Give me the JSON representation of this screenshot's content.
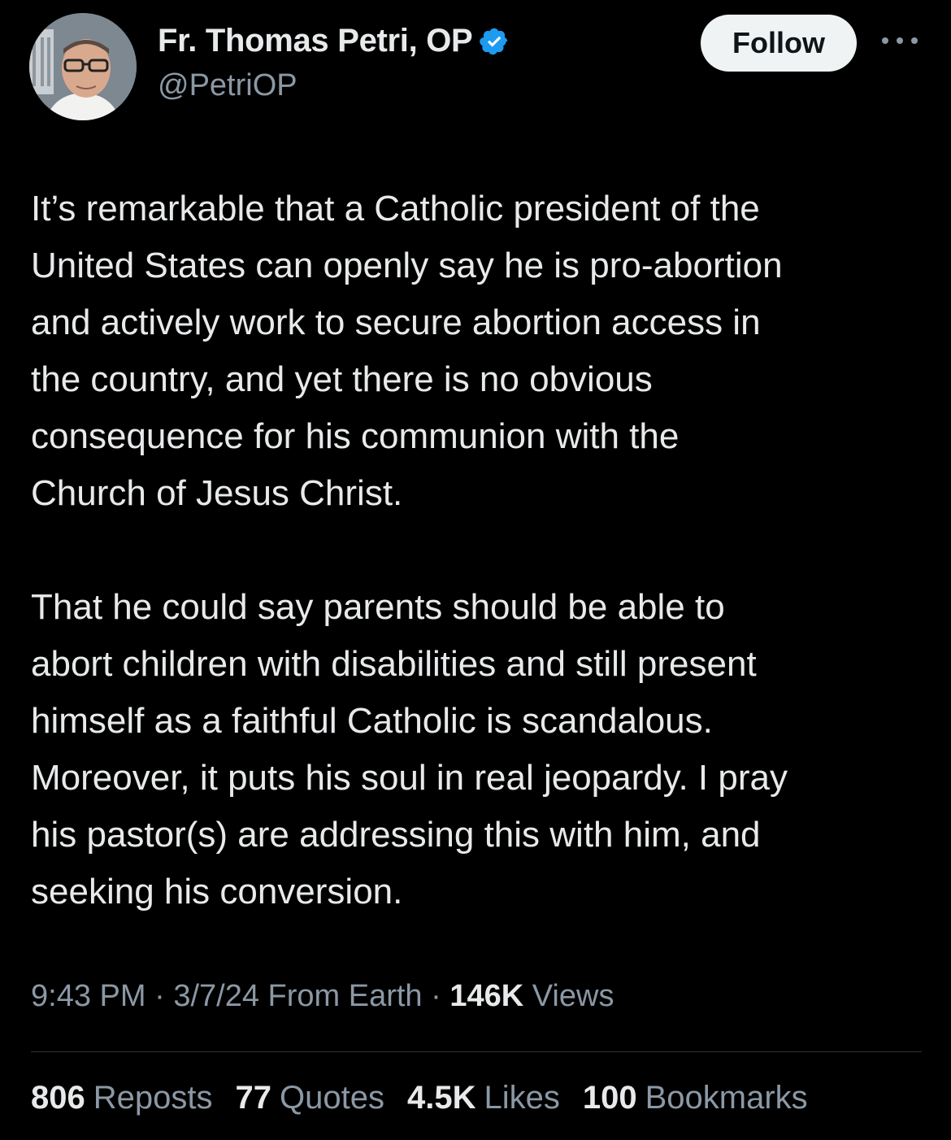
{
  "author": {
    "display_name": "Fr. Thomas Petri, OP",
    "handle": "@PetriOP",
    "verified_icon": "verified-badge-icon",
    "verified_color": "#1d9bf0"
  },
  "actions": {
    "follow_label": "Follow",
    "more_icon": "more-options-icon"
  },
  "tweet": {
    "paragraph_1": "It’s remarkable that a Catholic president of the\nUnited States can openly say he is pro-abortion\nand actively work to secure abortion access in\nthe country, and yet there is no obvious\nconsequence for his communion with the\nChurch of Jesus Christ.",
    "paragraph_2": "That he could say parents should be able to\nabort children with disabilities and still present\nhimself as a faithful Catholic is scandalous.\nMoreover, it puts his soul in real jeopardy. I pray\nhis pastor(s) are addressing this with him, and\nseeking his conversion."
  },
  "meta": {
    "time": "9:43 PM",
    "separator": " · ",
    "date": "3/7/24",
    "source": " From Earth",
    "views_count": "146K",
    "views_label": " Views"
  },
  "stats": [
    {
      "count": "806",
      "label": "Reposts"
    },
    {
      "count": "77",
      "label": "Quotes"
    },
    {
      "count": "4.5K",
      "label": "Likes"
    },
    {
      "count": "100",
      "label": "Bookmarks"
    }
  ],
  "colors": {
    "background": "#000000",
    "text_primary": "#e7e9ea",
    "text_secondary": "#8b98a5",
    "divider": "#2f3336",
    "follow_bg": "#eff3f4"
  }
}
